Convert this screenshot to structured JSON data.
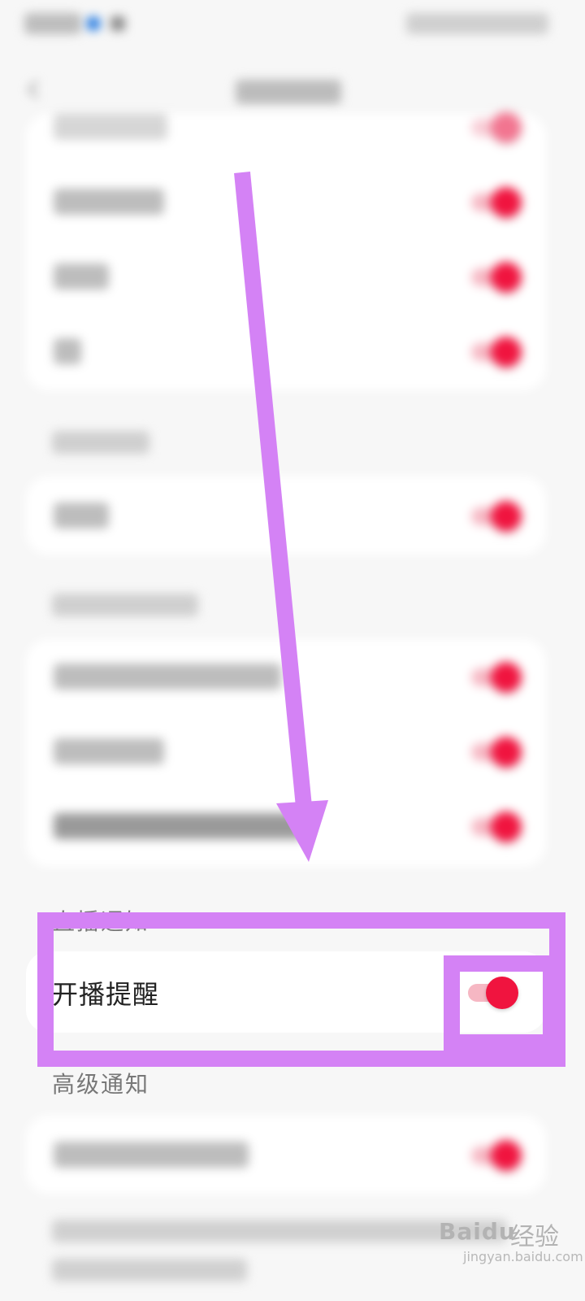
{
  "screen": {
    "accent_color": "#f0143f",
    "annotation_color": "#d482f5"
  },
  "sections": {
    "live_notification": {
      "title": "直播通知",
      "items": [
        {
          "label": "开播提醒",
          "enabled": true
        }
      ]
    },
    "advanced_notification": {
      "title": "高级通知"
    }
  },
  "watermark": {
    "brand": "Baidu",
    "brand_cn": "经验",
    "domain": "jingyan.baidu.com"
  },
  "icons": {
    "back": "chevron-left-icon"
  }
}
